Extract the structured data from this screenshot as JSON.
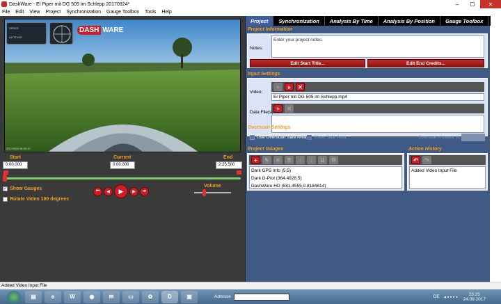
{
  "window": {
    "title": "DashWare - El Piper mit DG 505 im Schlepp 20170924*",
    "minimize": "–",
    "maximize": "☐",
    "close": "✕"
  },
  "menu": [
    "File",
    "Edit",
    "View",
    "Project",
    "Synchronization",
    "Gauge Toolbox",
    "Tools",
    "Help"
  ],
  "video": {
    "logo_text_a": "DASH",
    "logo_text_b": "WARE",
    "caption": "20170924 15:55:12",
    "gauge_labels": [
      "SPEED",
      "ALTITUDE"
    ]
  },
  "timeline": {
    "start_label": "Start",
    "start_value": "0:00.000",
    "current_label": "Current",
    "current_value": "0:00.000",
    "end_label": "End",
    "end_value": "2:25.500",
    "position_fraction": 0.0
  },
  "options": {
    "show_gauges": "Show Gauges",
    "show_gauges_checked": true,
    "rotate_video": "Rotate Video 180 degrees",
    "rotate_checked": false,
    "volume_label": "Volume",
    "volume_fraction": 0.3
  },
  "transport": {
    "first": "⏮",
    "prev": "◀",
    "play": "▶",
    "next": "▶",
    "last": "⏭"
  },
  "tabs": [
    "Project",
    "Synchronization",
    "Analysis By Time",
    "Analysis By Position",
    "Gauge Toolbox"
  ],
  "project_info": {
    "header": "Project Information",
    "notes_label": "Notes:",
    "notes_placeholder": "Enter your project notes.",
    "edit_start": "Edit Start Title...",
    "edit_end": "Edit End Credits..."
  },
  "input_settings": {
    "header": "Input Settings",
    "video_label": "Video:",
    "video_file": "El Piper mit DG 505 im Schlepp.mp4",
    "data_label": "Data File(s):"
  },
  "overscan": {
    "header": "Overscan Settings",
    "use_label": "Use Overscan Safe Area",
    "show_label": "Show Safe Area",
    "amount_label": "Overscan Amount %:"
  },
  "project_gauges": {
    "header": "Project Gauges",
    "items": [
      "Dark GPS Info (5,5)",
      "Dark G-Plot (364.4928,5)",
      "DashWare HD (581.4555,0.8184814)"
    ]
  },
  "action_history": {
    "header": "Action History",
    "items": [
      "Added Video Input File"
    ]
  },
  "status": "Added Video Input File",
  "taskbar": {
    "address_label": "Adresse",
    "lang": "DE",
    "time": "23:25",
    "date": "24.09.2017"
  }
}
